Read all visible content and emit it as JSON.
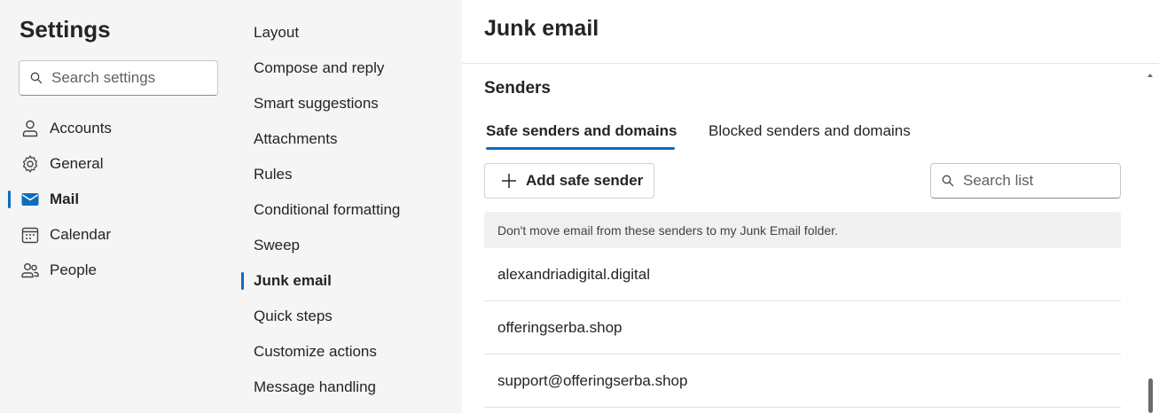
{
  "left": {
    "title": "Settings",
    "search_placeholder": "Search settings",
    "items": [
      {
        "label": "Accounts",
        "icon": "person-icon"
      },
      {
        "label": "General",
        "icon": "gear-icon"
      },
      {
        "label": "Mail",
        "icon": "mail-icon",
        "active": true
      },
      {
        "label": "Calendar",
        "icon": "calendar-icon"
      },
      {
        "label": "People",
        "icon": "people-icon"
      }
    ]
  },
  "middle": {
    "items": [
      {
        "label": "Layout"
      },
      {
        "label": "Compose and reply"
      },
      {
        "label": "Smart suggestions"
      },
      {
        "label": "Attachments"
      },
      {
        "label": "Rules"
      },
      {
        "label": "Conditional formatting"
      },
      {
        "label": "Sweep"
      },
      {
        "label": "Junk email",
        "active": true
      },
      {
        "label": "Quick steps"
      },
      {
        "label": "Customize actions"
      },
      {
        "label": "Message handling"
      }
    ]
  },
  "main": {
    "title": "Junk email",
    "section": "Senders",
    "tabs": [
      {
        "label": "Safe senders and domains",
        "selected": true
      },
      {
        "label": "Blocked senders and domains",
        "selected": false
      }
    ],
    "add_button": "Add safe sender",
    "list_search_placeholder": "Search list",
    "list_header": "Don't move email from these senders to my Junk Email folder.",
    "entries": [
      "alexandriadigital.digital",
      "offeringserba.shop",
      "support@offeringserba.shop"
    ]
  },
  "colors": {
    "accent": "#0f6cbd",
    "pane_bg": "#f5f5f5",
    "content_bg": "#ffffff"
  }
}
